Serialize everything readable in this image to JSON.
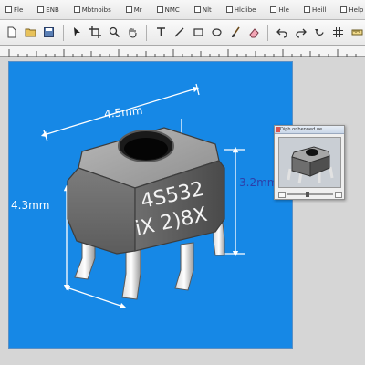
{
  "menubar": {
    "items": [
      {
        "label": "Fle",
        "icon": "file-icon"
      },
      {
        "label": "ENB",
        "icon": "edit-icon"
      },
      {
        "label": "Mbtnoibs",
        "icon": "tools-icon"
      },
      {
        "label": "Mr",
        "icon": "view-icon"
      },
      {
        "label": "NMC",
        "icon": "image-icon"
      },
      {
        "label": "Nlt",
        "icon": "layer-icon"
      },
      {
        "label": "Hlclibe",
        "icon": "select-icon"
      },
      {
        "label": "Hle",
        "icon": "filter-icon"
      },
      {
        "label": "Heill",
        "icon": "window-icon"
      },
      {
        "label": "Help",
        "icon": "help-icon"
      }
    ]
  },
  "drawing": {
    "part_line1": "4S532",
    "part_line2": "iX 2)8X",
    "dim_width": "4.5mm",
    "dim_height": "3.2mm",
    "dim_left": "4.3mm",
    "colors": {
      "canvas_bg": "#1688e6",
      "dim_line": "#ffffff",
      "body_gray": "#8a8a8a"
    }
  },
  "preview": {
    "title": "Diph onbenned ue"
  }
}
